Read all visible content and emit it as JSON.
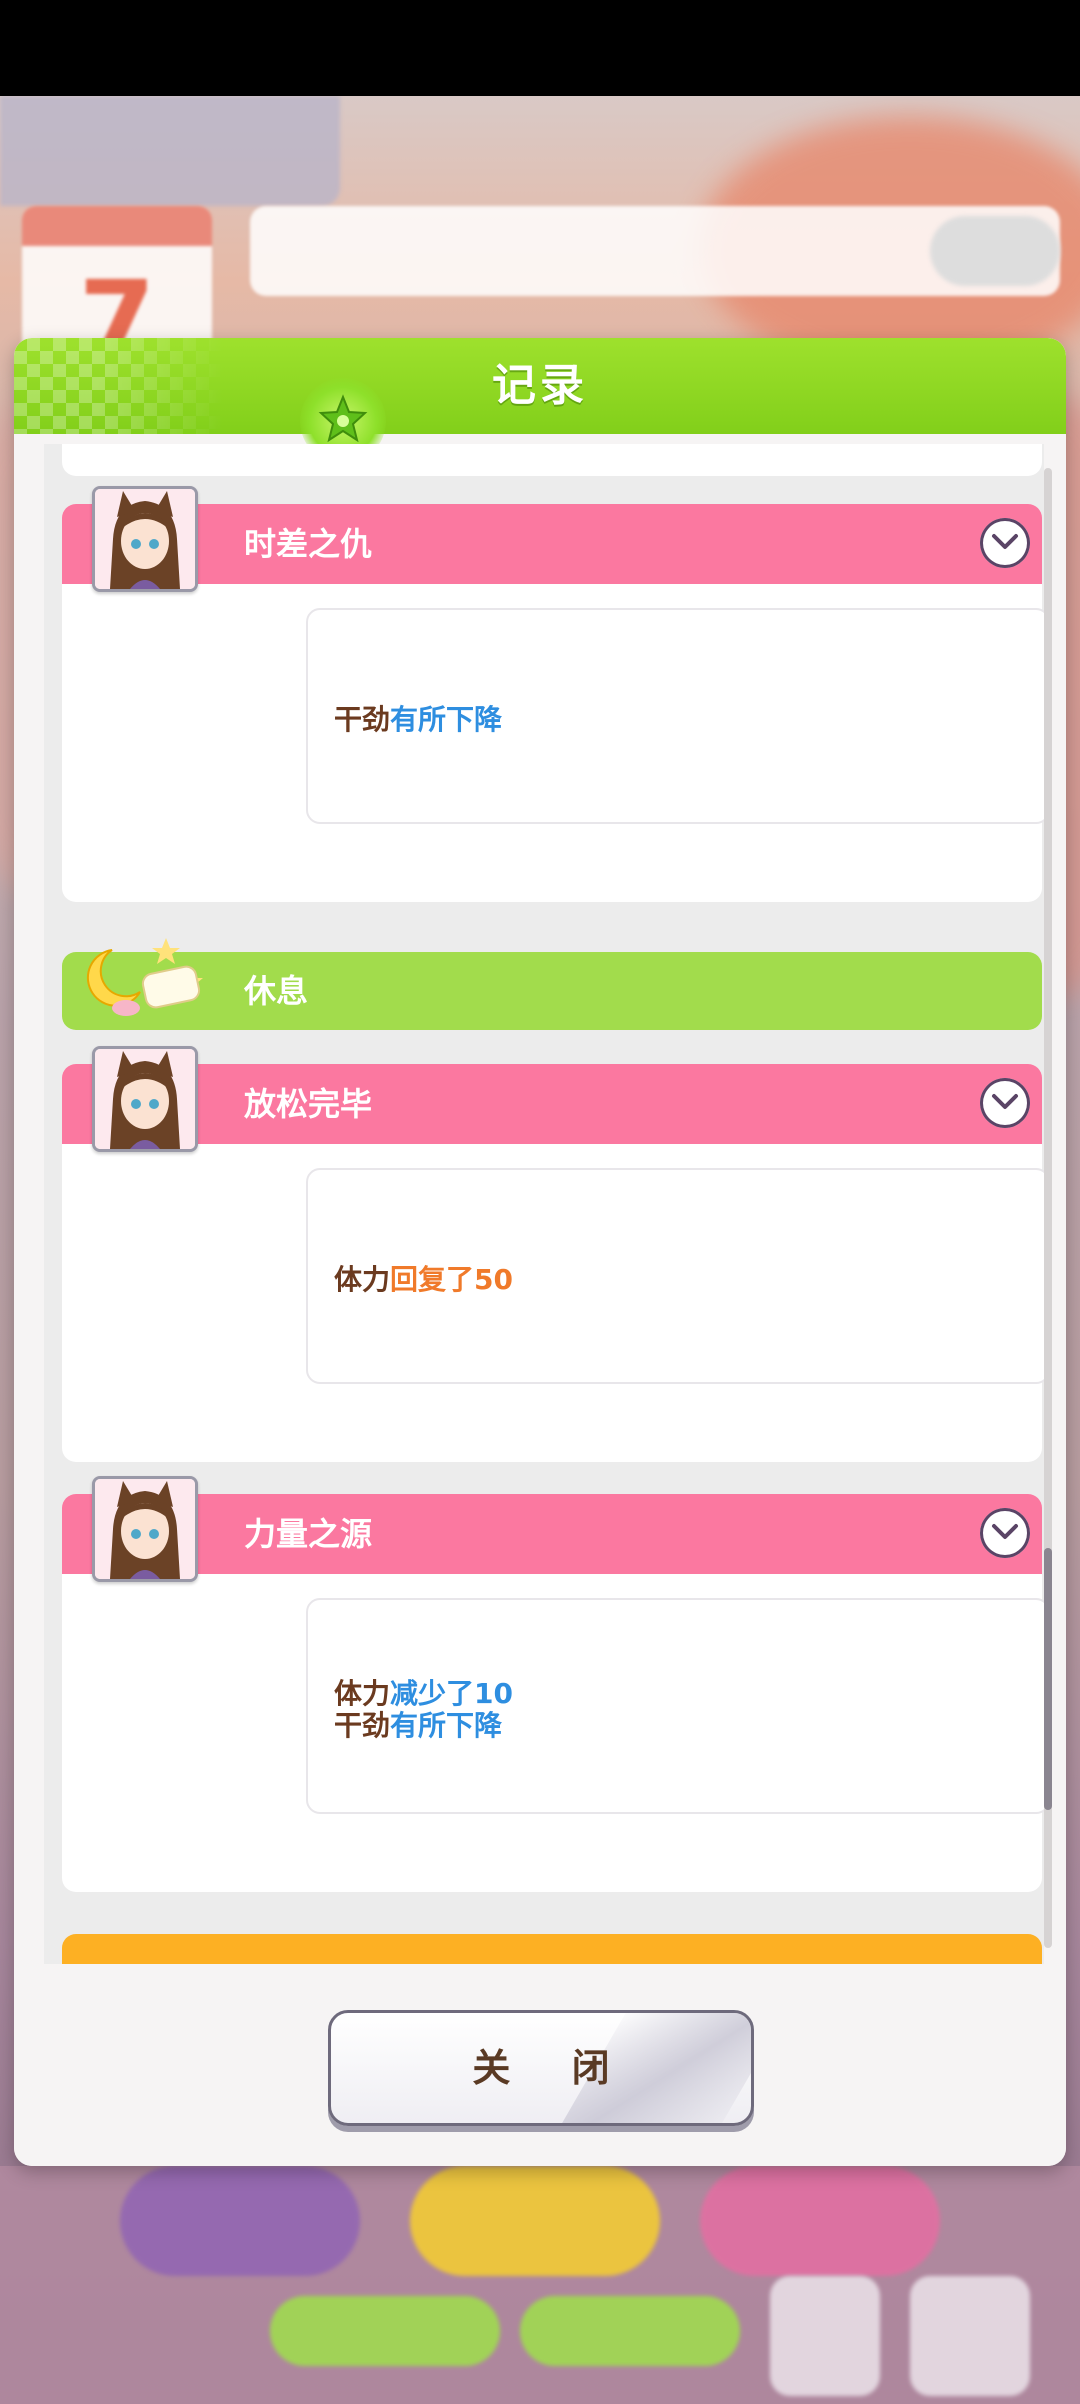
{
  "dialog": {
    "title": "记录",
    "close_label": "关 闭"
  },
  "entries": [
    {
      "type": "event",
      "title": "时差之仇",
      "effects": [
        {
          "stat": "干劲",
          "change": "有所下降",
          "color": "blue"
        }
      ]
    },
    {
      "type": "rest",
      "title": "休息"
    },
    {
      "type": "event",
      "title": "放松完毕",
      "effects": [
        {
          "stat": "体力",
          "change": "回复了50",
          "color": "orange"
        }
      ]
    },
    {
      "type": "event",
      "title": "力量之源",
      "effects": [
        {
          "stat": "体力",
          "change": "减少了10",
          "color": "blue"
        },
        {
          "stat": "干劲",
          "change": "有所下降",
          "color": "blue"
        }
      ]
    }
  ],
  "background": {
    "calendar_number": "7"
  },
  "colors": {
    "header_green": "#8ad420",
    "event_pink": "#fb78a0",
    "rest_green": "#a2dc4c",
    "next_orange": "#fdb023",
    "text_brown": "#6b3a1f",
    "effect_blue": "#2e8ee0",
    "effect_orange": "#f07a2a"
  }
}
